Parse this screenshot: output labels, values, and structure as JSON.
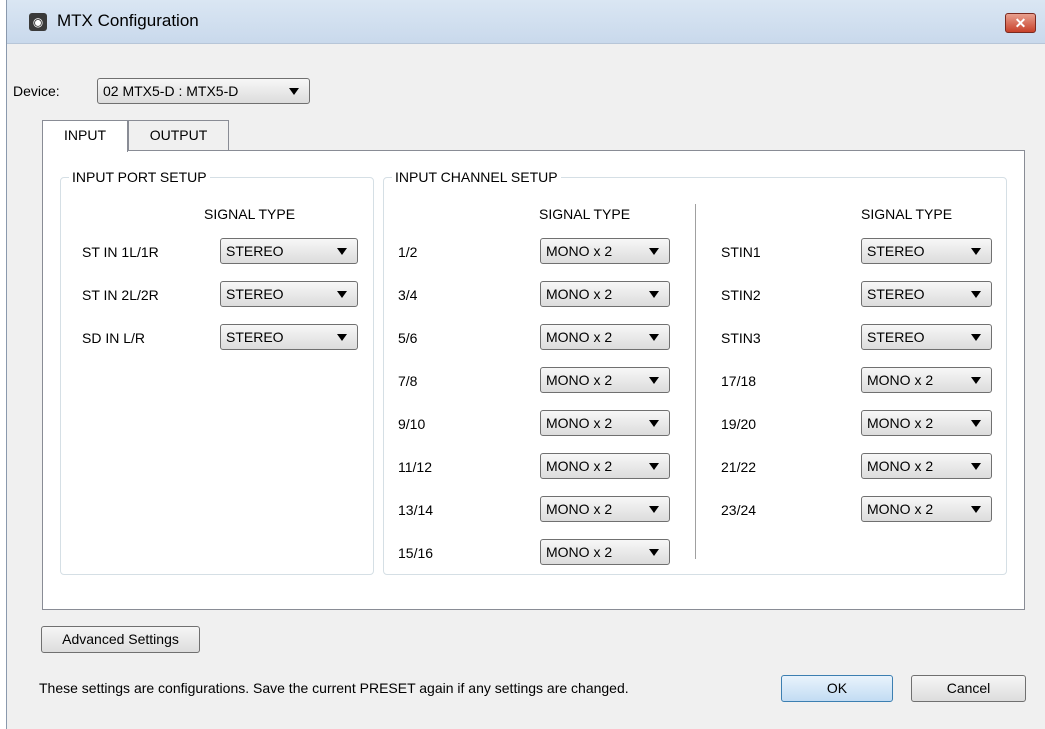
{
  "window": {
    "title": "MTX Configuration",
    "close_glyph": "✕",
    "app_icon": "speaker-icon",
    "app_icon_glyph": "◉"
  },
  "device": {
    "label": "Device:",
    "value": "02 MTX5-D : MTX5-D"
  },
  "tabs": [
    {
      "label": "INPUT",
      "active": true
    },
    {
      "label": "OUTPUT",
      "active": false
    }
  ],
  "input_port_setup": {
    "title": "INPUT PORT SETUP",
    "header": "SIGNAL TYPE",
    "rows": [
      {
        "label": "ST IN 1L/1R",
        "value": "STEREO"
      },
      {
        "label": "ST IN 2L/2R",
        "value": "STEREO"
      },
      {
        "label": "SD IN L/R",
        "value": "STEREO"
      }
    ]
  },
  "input_channel_setup": {
    "title": "INPUT CHANNEL SETUP",
    "left": {
      "header": "SIGNAL TYPE",
      "rows": [
        {
          "label": "1/2",
          "value": "MONO x 2"
        },
        {
          "label": "3/4",
          "value": "MONO x 2"
        },
        {
          "label": "5/6",
          "value": "MONO x 2"
        },
        {
          "label": "7/8",
          "value": "MONO x 2"
        },
        {
          "label": "9/10",
          "value": "MONO x 2"
        },
        {
          "label": "11/12",
          "value": "MONO x 2"
        },
        {
          "label": "13/14",
          "value": "MONO x 2"
        },
        {
          "label": "15/16",
          "value": "MONO x 2"
        }
      ]
    },
    "right": {
      "header": "SIGNAL TYPE",
      "rows": [
        {
          "label": "STIN1",
          "value": "STEREO"
        },
        {
          "label": "STIN2",
          "value": "STEREO"
        },
        {
          "label": "STIN3",
          "value": "STEREO"
        },
        {
          "label": "17/18",
          "value": "MONO x 2"
        },
        {
          "label": "19/20",
          "value": "MONO x 2"
        },
        {
          "label": "21/22",
          "value": "MONO x 2"
        },
        {
          "label": "23/24",
          "value": "MONO x 2"
        }
      ]
    }
  },
  "footer": {
    "advanced_label": "Advanced Settings",
    "note": "These settings are configurations. Save the current PRESET again if any settings are changed.",
    "ok_label": "OK",
    "cancel_label": "Cancel"
  }
}
